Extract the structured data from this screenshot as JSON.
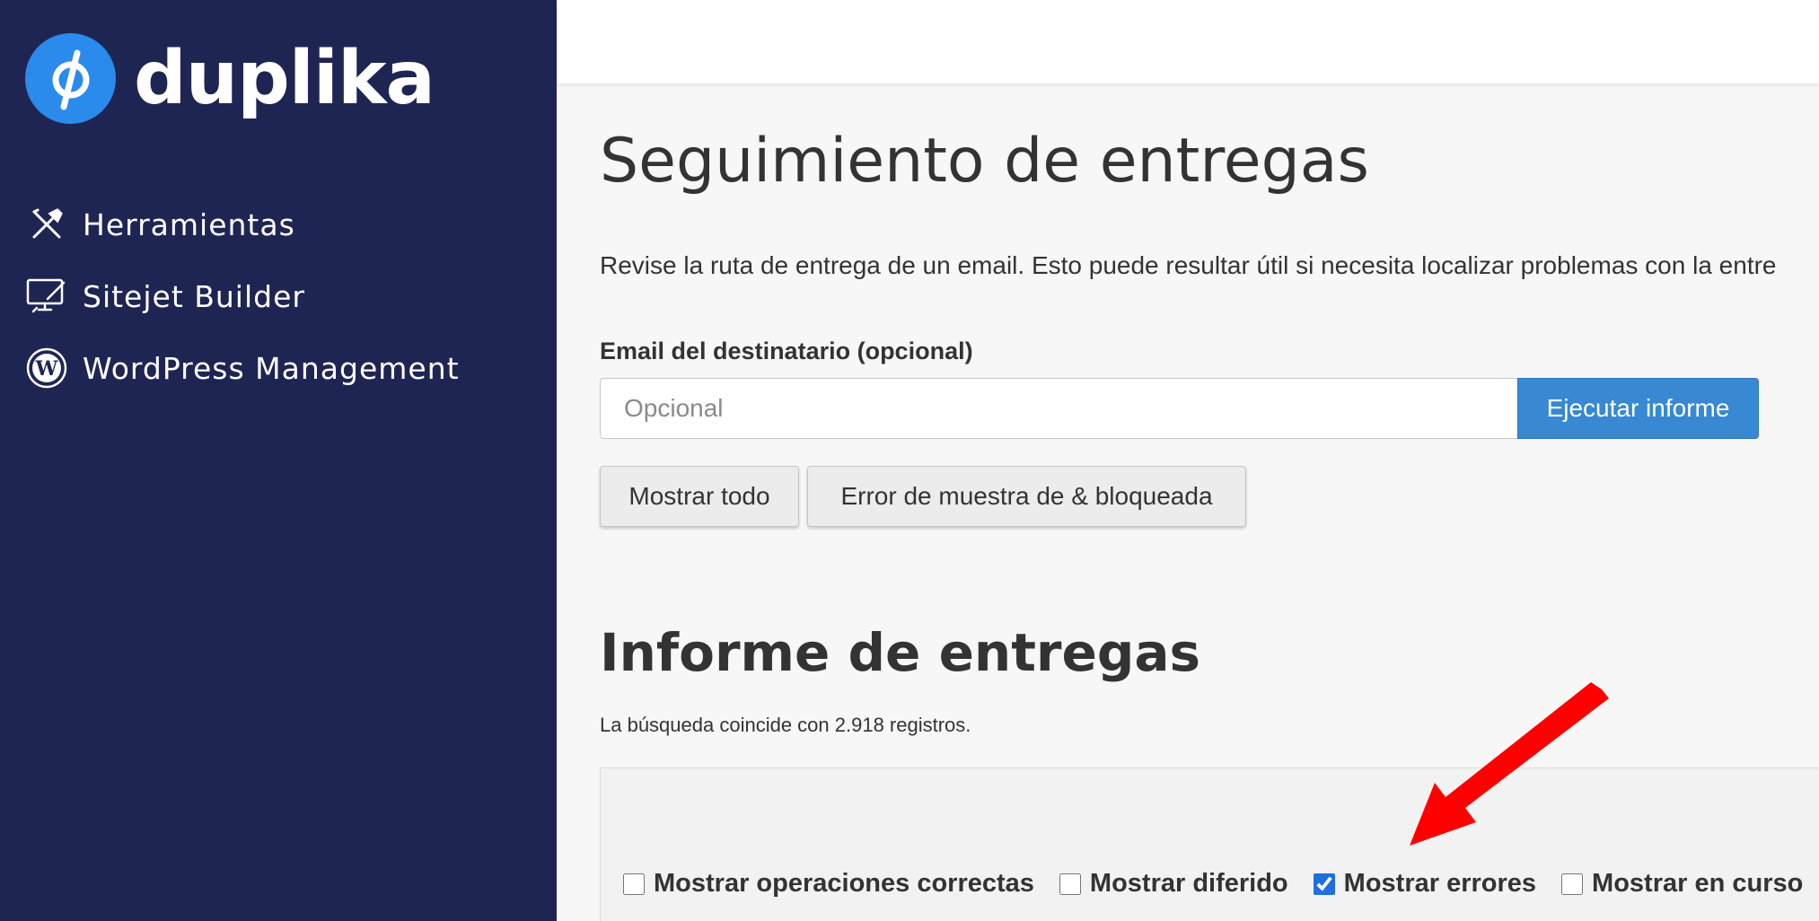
{
  "sidebar": {
    "logo_text": "duplika",
    "items": [
      {
        "label": "Herramientas",
        "icon": "tools-icon"
      },
      {
        "label": "Sitejet Builder",
        "icon": "monitor-pen-icon"
      },
      {
        "label": "WordPress Management",
        "icon": "wordpress-icon"
      }
    ]
  },
  "main": {
    "title": "Seguimiento de entregas",
    "description": "Revise la ruta de entrega de un email. Esto puede resultar útil si necesita localizar problemas con la entre",
    "email_label": "Email del destinatario (opcional)",
    "email_placeholder": "Opcional",
    "email_value": "",
    "run_button": "Ejecutar informe",
    "show_all_button": "Mostrar todo",
    "show_errors_button": "Error de muestra de & bloqueada"
  },
  "report": {
    "title": "Informe de entregas",
    "match_text": "La búsqueda coincide con 2.918 registros.",
    "filters": [
      {
        "label": "Mostrar operaciones correctas",
        "checked": false
      },
      {
        "label": "Mostrar diferido",
        "checked": false
      },
      {
        "label": "Mostrar errores",
        "checked": true
      },
      {
        "label": "Mostrar en curso",
        "checked": false
      }
    ]
  },
  "colors": {
    "sidebar_bg": "#1f2553",
    "accent": "#3888d2",
    "logo_circle": "#2a8bec",
    "annotation_arrow": "#ff0000"
  }
}
